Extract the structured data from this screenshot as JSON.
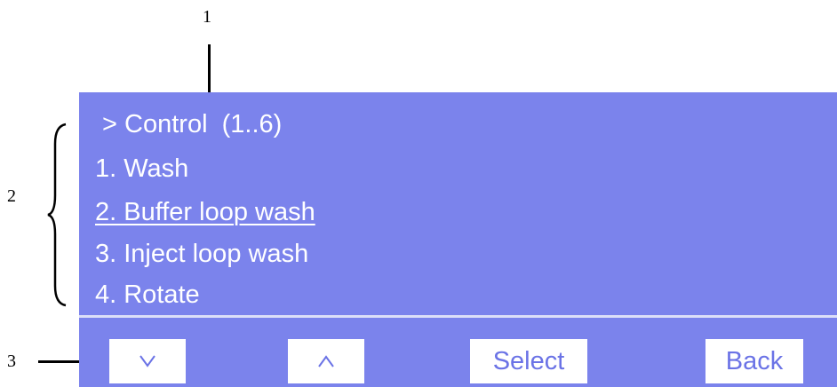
{
  "callouts": {
    "one": "1",
    "two": "2",
    "three": "3"
  },
  "screen": {
    "title": " > Control  (1..6)",
    "items": [
      {
        "label": "1. Wash",
        "selected": false
      },
      {
        "label": "2. Buffer loop wash",
        "selected": true
      },
      {
        "label": "3. Inject loop wash",
        "selected": false
      },
      {
        "label": "4. Rotate",
        "selected": false
      }
    ]
  },
  "softkeys": {
    "down": "v",
    "up": "^",
    "select": "Select",
    "back": "Back"
  },
  "colors": {
    "panel": "#7b83ec",
    "key_text": "#6b73e6",
    "divider": "#dcdff8"
  }
}
